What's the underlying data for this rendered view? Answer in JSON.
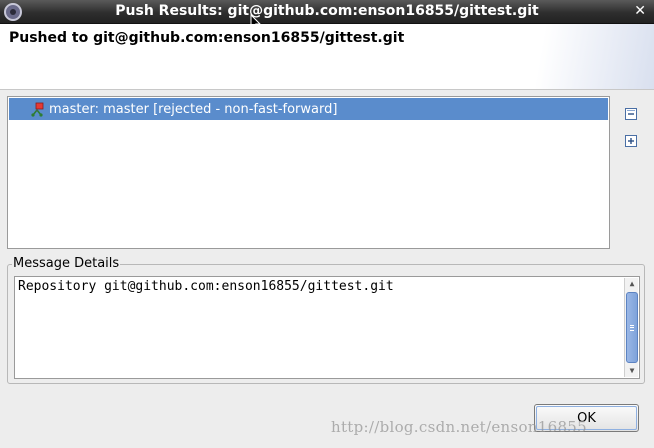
{
  "window": {
    "title": "Push Results: git@github.com:enson16855/gittest.git",
    "close_glyph": "✕"
  },
  "header": {
    "message": "Pushed to git@github.com:enson16855/gittest.git"
  },
  "results": {
    "rows": [
      {
        "label": "master: master [rejected - non-fast-forward]",
        "icon": "git-ref-icon",
        "selected": true
      }
    ]
  },
  "side_buttons": {
    "collapse_all_icon": "collapse-all-icon",
    "expand_all_icon": "expand-all-icon"
  },
  "details": {
    "group_label": "Message Details",
    "text": "Repository git@github.com:enson16855/gittest.git"
  },
  "buttons": {
    "ok_label": "OK"
  },
  "watermark": {
    "text": "http://blog.csdn.net/enson16855"
  },
  "colors": {
    "selection": "#5a8ccc",
    "titlebar": "#2e2e2e"
  }
}
